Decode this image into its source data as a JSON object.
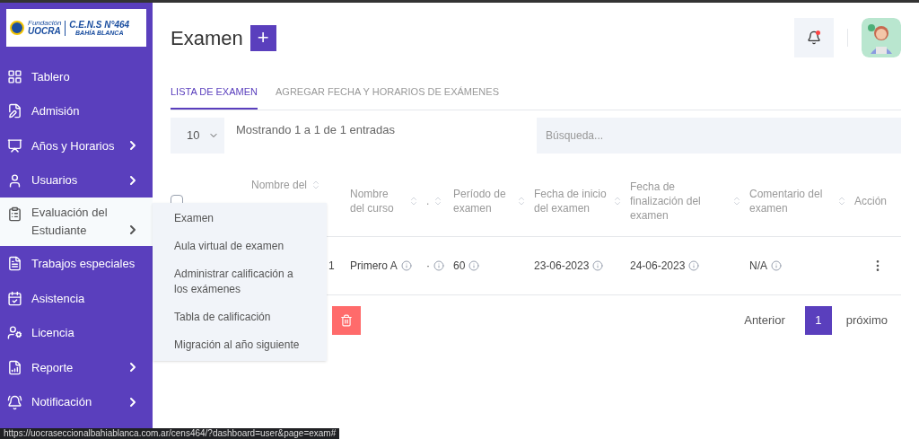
{
  "logo": {
    "org": "Fundación",
    "org_name": "UOCRA",
    "school": "C.E.N.S N°464",
    "city": "BAHÍA BLANCA"
  },
  "sidebar": {
    "items": [
      {
        "label": "Tablero",
        "has_submenu": false,
        "selected": false
      },
      {
        "label": "Admisión",
        "has_submenu": false,
        "selected": false
      },
      {
        "label": "Años y Horarios",
        "has_submenu": true,
        "selected": false,
        "expanded": false
      },
      {
        "label": "Usuarios",
        "has_submenu": true,
        "selected": false,
        "expanded": false
      },
      {
        "label": "Evaluación del Estudiante",
        "has_submenu": true,
        "selected": true,
        "expanded": true,
        "children": [
          "Examen",
          "Aula virtual de examen",
          "Administrar calificación a los exámenes",
          "Tabla de calificación",
          "Migración al año siguiente"
        ]
      },
      {
        "label": "Trabajos especiales",
        "has_submenu": false,
        "selected": false
      },
      {
        "label": "Asistencia",
        "has_submenu": false,
        "selected": false
      },
      {
        "label": "Licencia",
        "has_submenu": false,
        "selected": false
      },
      {
        "label": "Reporte",
        "has_submenu": true,
        "selected": false,
        "expanded": false
      },
      {
        "label": "Notificación",
        "has_submenu": true,
        "selected": false,
        "expanded": false
      }
    ]
  },
  "header": {
    "title": "Examen",
    "add_button": "+",
    "notification_unread": true
  },
  "tabs": [
    {
      "label": "LISTA DE EXAMEN",
      "selected": true
    },
    {
      "label": "AGREGAR FECHA Y HORARIOS DE EXÁMENES",
      "selected": false
    }
  ],
  "table_controls": {
    "page_size": "10",
    "info": "Mostrando 1 a 1 de 1 entradas",
    "search_placeholder": "Búsqueda..."
  },
  "table": {
    "select_all_checked": false,
    "columns": [
      "",
      "Nombre del",
      "Nombre del curso",
      ".",
      "Período de examen",
      "Fecha de inicio del examen",
      "Fecha de finalización del examen",
      "Comentario del examen",
      "Acción"
    ],
    "rows": [
      {
        "cells": [
          "",
          "1",
          "Primero A",
          "·",
          "60",
          "23-06-2023",
          "24-06-2023",
          "N/A"
        ]
      }
    ]
  },
  "pagination": {
    "previous": "Anterior",
    "pages": [
      {
        "label": "1",
        "selected": true
      }
    ],
    "next": "próximo"
  },
  "status_bar": {
    "url": "https://uocraseccionalbahiablanca.com.ar/cens464/?dashboard=user&page=exam#"
  }
}
